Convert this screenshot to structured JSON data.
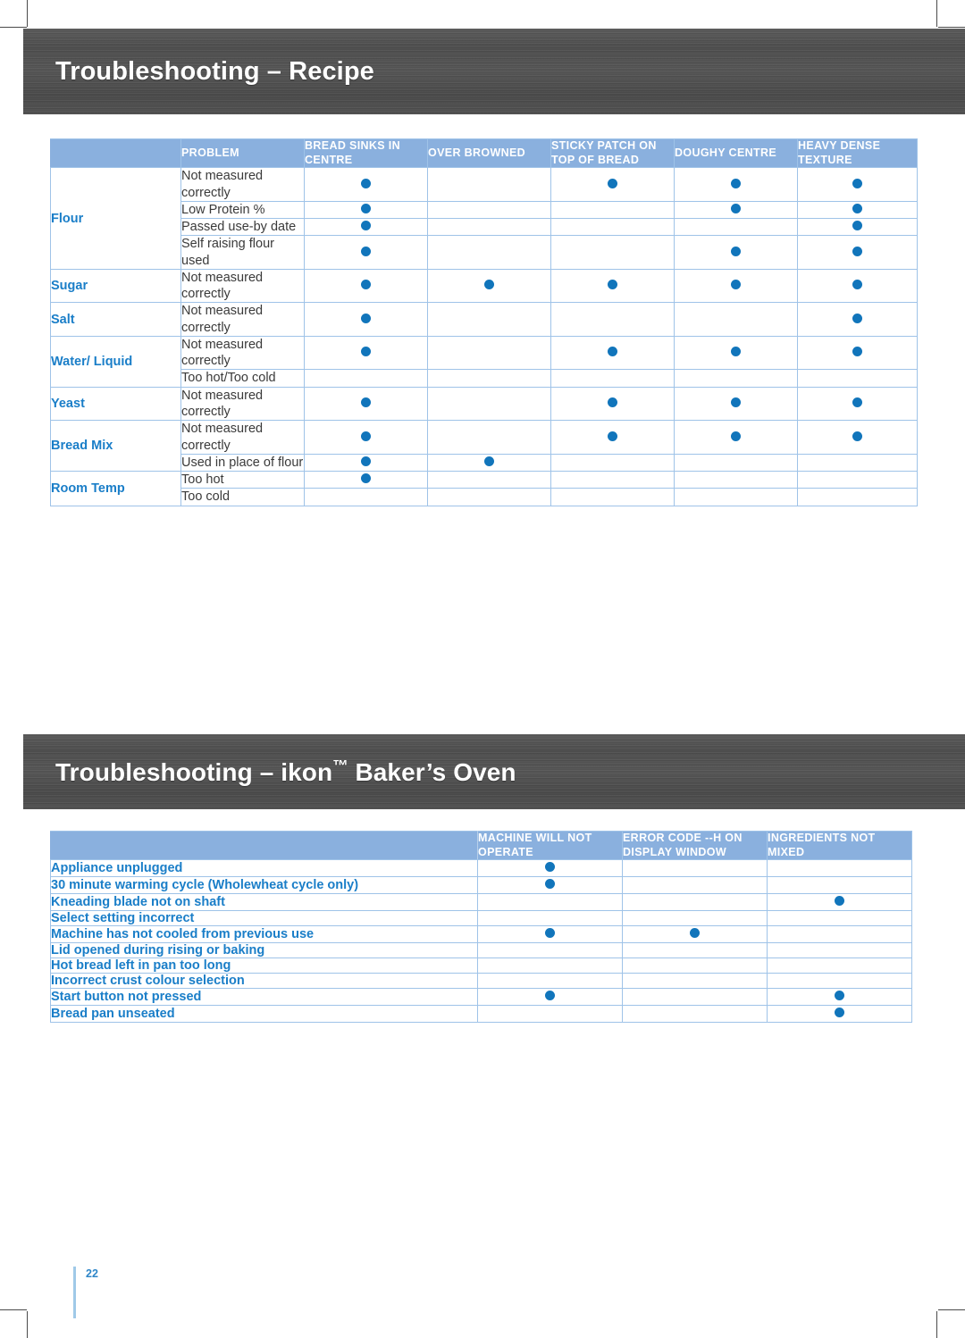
{
  "page": {
    "number": "22",
    "accent_blue": "#1a7ec8",
    "header_blue": "#8AB0DE",
    "dot_blue": "#1175bb",
    "banner_grey": "#4e4e4e"
  },
  "section_recipe": {
    "banner_title": "Troubleshooting – Recipe",
    "table": {
      "headers": [
        "",
        "PROBLEM",
        "BREAD SINKS IN CENTRE",
        "OVER BROWNED",
        "STICKY PATCH ON TOP OF BREAD",
        "DOUGHY CENTRE",
        "HEAVY DENSE TEXTURE"
      ],
      "column_keys": [
        "category",
        "problem",
        "bread_sinks_in_centre",
        "over_browned",
        "sticky_patch_on_top_of_bread",
        "doughy_centre",
        "heavy_dense_texture"
      ],
      "groups": [
        {
          "category": "Flour",
          "rows": [
            {
              "problem": "Not measured correctly",
              "marks": [
                true,
                false,
                true,
                true,
                true
              ]
            },
            {
              "problem": "Low Protein %",
              "marks": [
                true,
                false,
                false,
                true,
                true
              ]
            },
            {
              "problem": "Passed use-by date",
              "marks": [
                true,
                false,
                false,
                false,
                true
              ]
            },
            {
              "problem": "Self raising flour used",
              "marks": [
                true,
                false,
                false,
                true,
                true
              ]
            }
          ]
        },
        {
          "category": "Sugar",
          "rows": [
            {
              "problem": "Not measured correctly",
              "marks": [
                true,
                true,
                true,
                true,
                true
              ]
            }
          ]
        },
        {
          "category": "Salt",
          "rows": [
            {
              "problem": "Not measured correctly",
              "marks": [
                true,
                false,
                false,
                false,
                true
              ]
            }
          ]
        },
        {
          "category": "Water/ Liquid",
          "rows": [
            {
              "problem": "Not measured correctly",
              "marks": [
                true,
                false,
                true,
                true,
                true
              ]
            },
            {
              "problem": "Too hot/Too cold",
              "marks": [
                false,
                false,
                false,
                false,
                false
              ]
            }
          ]
        },
        {
          "category": "Yeast",
          "rows": [
            {
              "problem": "Not measured correctly",
              "marks": [
                true,
                false,
                true,
                true,
                true
              ]
            }
          ]
        },
        {
          "category": "Bread Mix",
          "rows": [
            {
              "problem": "Not measured correctly",
              "marks": [
                true,
                false,
                true,
                true,
                true
              ]
            },
            {
              "problem": "Used in place of flour",
              "marks": [
                true,
                true,
                false,
                false,
                false
              ]
            }
          ]
        },
        {
          "category": "Room Temp",
          "rows": [
            {
              "problem": "Too hot",
              "marks": [
                true,
                false,
                false,
                false,
                false
              ]
            },
            {
              "problem": "Too cold",
              "marks": [
                false,
                false,
                false,
                false,
                false
              ]
            }
          ]
        }
      ]
    }
  },
  "section_oven": {
    "banner_title_parts": {
      "before": "Troubleshooting – ikon",
      "tm": "™",
      "after": " Baker’s Oven"
    },
    "banner_title": "Troubleshooting – ikon™ Baker’s Oven",
    "table": {
      "headers": [
        "",
        "MACHINE WILL NOT OPERATE",
        "ERROR CODE --H ON DISPLAY WINDOW",
        "INGREDIENTS NOT MIXED"
      ],
      "column_keys": [
        "cause",
        "machine_will_not_operate",
        "error_code_h_on_display_window",
        "ingredients_not_mixed"
      ],
      "rows": [
        {
          "cause": "Appliance unplugged",
          "marks": [
            true,
            false,
            false
          ]
        },
        {
          "cause": "30 minute warming cycle (Wholewheat cycle only)",
          "marks": [
            true,
            false,
            false
          ]
        },
        {
          "cause": "Kneading blade not on shaft",
          "marks": [
            false,
            false,
            true
          ]
        },
        {
          "cause": "Select setting incorrect",
          "marks": [
            false,
            false,
            false
          ]
        },
        {
          "cause": "Machine has not cooled from previous use",
          "marks": [
            true,
            true,
            false
          ]
        },
        {
          "cause": "Lid opened during rising or baking",
          "marks": [
            false,
            false,
            false
          ]
        },
        {
          "cause": "Hot bread left in pan too long",
          "marks": [
            false,
            false,
            false
          ]
        },
        {
          "cause": "Incorrect crust colour selection",
          "marks": [
            false,
            false,
            false
          ]
        },
        {
          "cause": "Start button not pressed",
          "marks": [
            true,
            false,
            true
          ]
        },
        {
          "cause": "Bread pan unseated",
          "marks": [
            false,
            false,
            true
          ]
        }
      ]
    }
  }
}
